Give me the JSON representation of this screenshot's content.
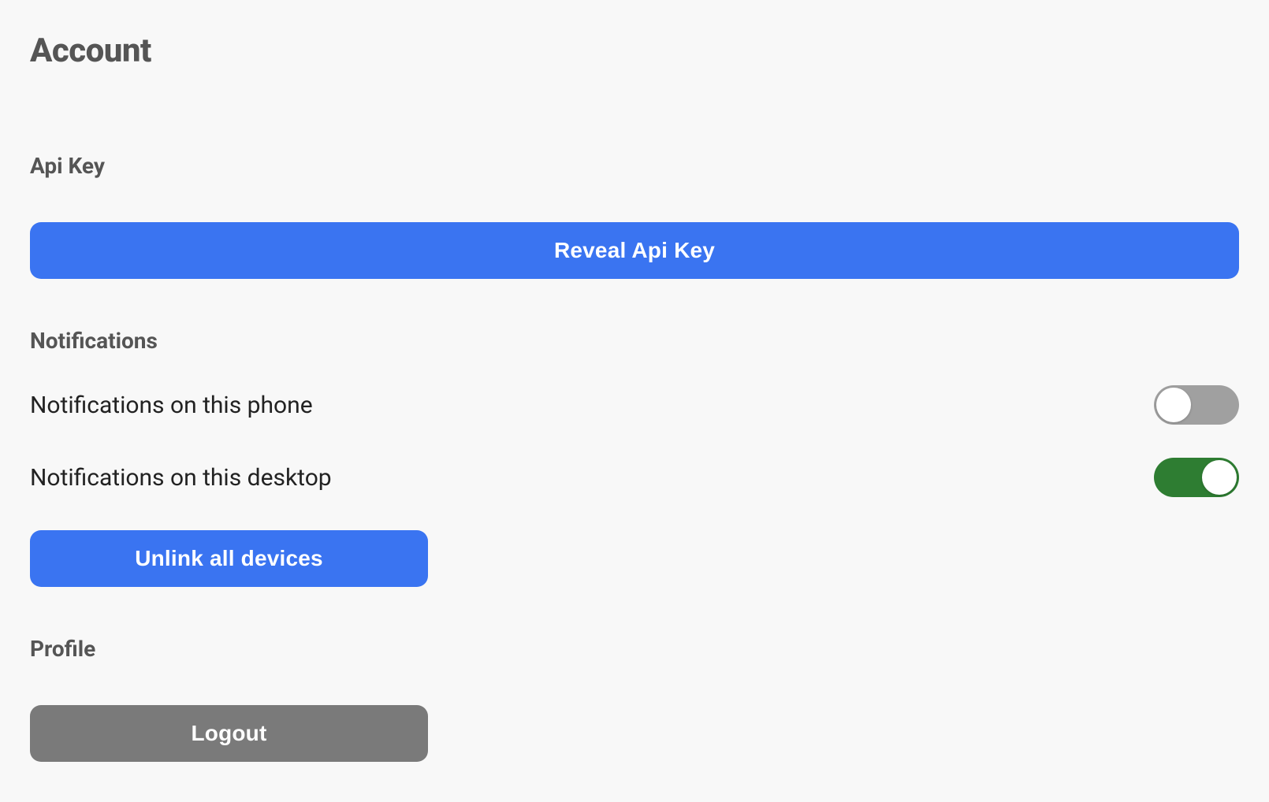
{
  "page": {
    "title": "Account"
  },
  "api_key": {
    "heading": "Api Key",
    "reveal_button": "Reveal Api Key"
  },
  "notifications": {
    "heading": "Notifications",
    "phone_label": "Notifications on this phone",
    "phone_enabled": false,
    "desktop_label": "Notifications on this desktop",
    "desktop_enabled": true,
    "unlink_button": "Unlink all devices"
  },
  "profile": {
    "heading": "Profile",
    "logout_button": "Logout"
  },
  "colors": {
    "primary": "#3A74F1",
    "secondary": "#7A7A7A",
    "toggle_on": "#2e7d32",
    "toggle_off": "#a0a0a0",
    "text_heading": "#555555",
    "text_body": "#222222",
    "background": "#f8f8f8"
  }
}
